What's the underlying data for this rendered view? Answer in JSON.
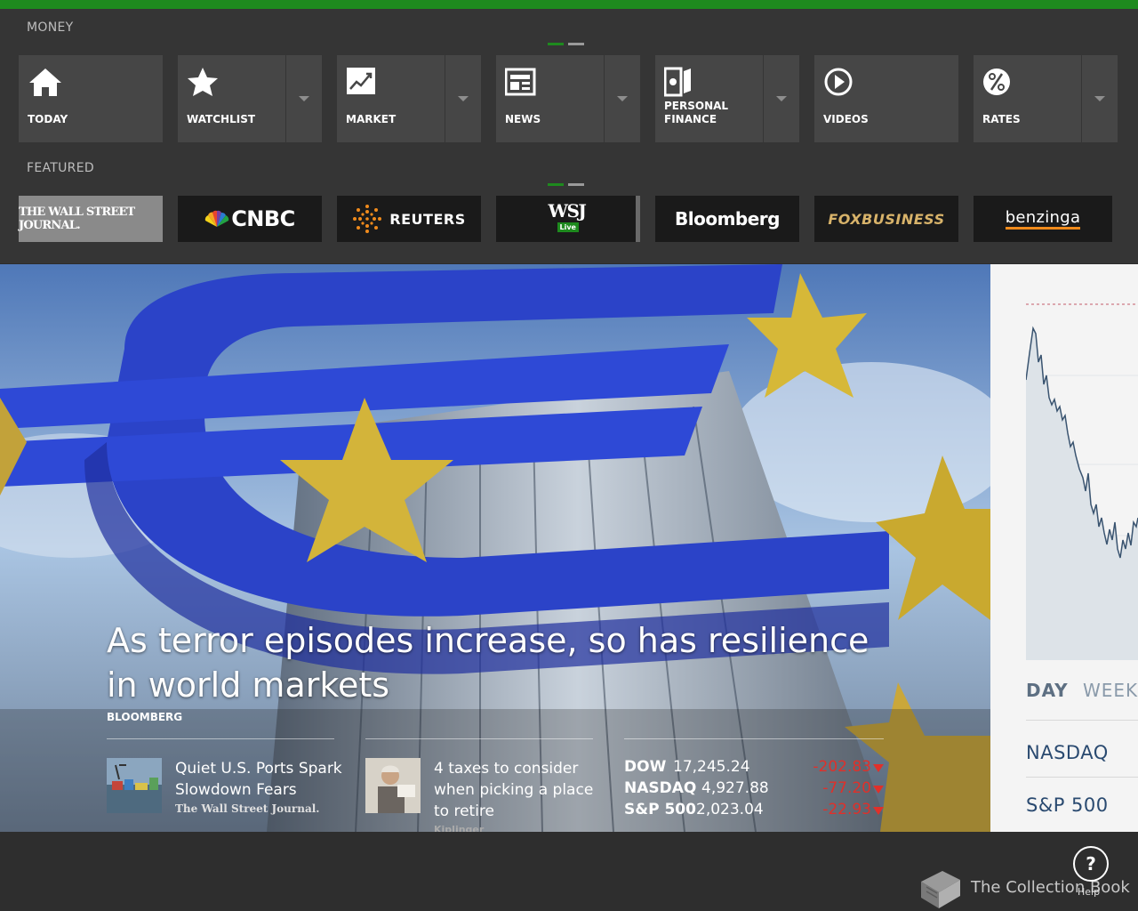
{
  "sections": {
    "money_label": "MONEY",
    "featured_label": "FEATURED"
  },
  "nav_tiles": [
    {
      "label": "TODAY",
      "icon": "home-icon",
      "has_dropdown": false
    },
    {
      "label": "WATCHLIST",
      "icon": "star-icon",
      "has_dropdown": true
    },
    {
      "label": "MARKET",
      "icon": "market-chart-icon",
      "has_dropdown": true
    },
    {
      "label": "NEWS",
      "icon": "newspaper-icon",
      "has_dropdown": true
    },
    {
      "label": "PERSONAL FINANCE",
      "icon": "money-wallet-icon",
      "has_dropdown": true
    },
    {
      "label": "VIDEOS",
      "icon": "play-icon",
      "has_dropdown": false
    },
    {
      "label": "RATES",
      "icon": "percent-icon",
      "has_dropdown": true
    }
  ],
  "featured_sources": [
    {
      "name": "THE WALL STREET JOURNAL."
    },
    {
      "name": "CNBC"
    },
    {
      "name": "REUTERS"
    },
    {
      "name": "WSJ",
      "badge": "Live"
    },
    {
      "name": "Bloomberg"
    },
    {
      "name": "FOXBUSINESS"
    },
    {
      "name": "benzinga"
    }
  ],
  "hero": {
    "headline": "As terror episodes increase, so has resilience in world markets",
    "source": "BLOOMBERG"
  },
  "stories": [
    {
      "title": "Quiet U.S. Ports Spark Slowdown Fears",
      "source": "The Wall Street Journal."
    },
    {
      "title": "4 taxes to consider when picking a place to retire",
      "source": "Kiplinger"
    }
  ],
  "quotes": [
    {
      "symbol": "DOW",
      "value": "17,245.24",
      "change": "-202.83"
    },
    {
      "symbol": "NASDAQ",
      "value": "4,927.88",
      "change": "-77.20"
    },
    {
      "symbol": "S&P 500",
      "value": "2,023.04",
      "change": "-22.93"
    }
  ],
  "side_panel": {
    "tabs": [
      "DAY",
      "WEEK"
    ],
    "indices": [
      "NASDAQ",
      "S&P 500"
    ]
  },
  "help": {
    "glyph": "?",
    "label": "Help"
  },
  "collection": {
    "label": "The Collection Book"
  },
  "colors": {
    "accent": "#1e8a1e",
    "negative": "#e0302a",
    "panel": "#353535"
  }
}
